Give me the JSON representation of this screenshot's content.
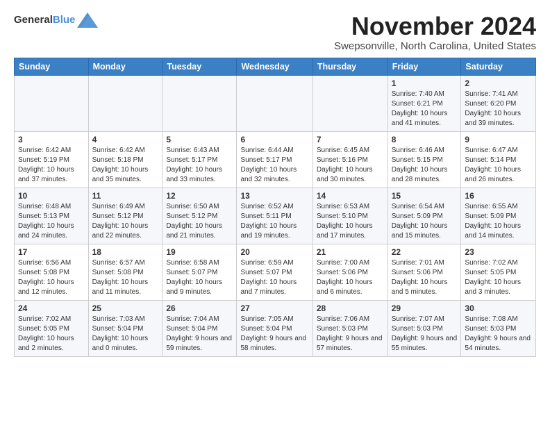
{
  "header": {
    "logo_general": "General",
    "logo_blue": "Blue",
    "month_title": "November 2024",
    "location": "Swepsonville, North Carolina, United States"
  },
  "weekdays": [
    "Sunday",
    "Monday",
    "Tuesday",
    "Wednesday",
    "Thursday",
    "Friday",
    "Saturday"
  ],
  "weeks": [
    [
      {
        "day": "",
        "info": ""
      },
      {
        "day": "",
        "info": ""
      },
      {
        "day": "",
        "info": ""
      },
      {
        "day": "",
        "info": ""
      },
      {
        "day": "",
        "info": ""
      },
      {
        "day": "1",
        "info": "Sunrise: 7:40 AM\nSunset: 6:21 PM\nDaylight: 10 hours\nand 41 minutes."
      },
      {
        "day": "2",
        "info": "Sunrise: 7:41 AM\nSunset: 6:20 PM\nDaylight: 10 hours\nand 39 minutes."
      }
    ],
    [
      {
        "day": "3",
        "info": "Sunrise: 6:42 AM\nSunset: 5:19 PM\nDaylight: 10 hours\nand 37 minutes."
      },
      {
        "day": "4",
        "info": "Sunrise: 6:42 AM\nSunset: 5:18 PM\nDaylight: 10 hours\nand 35 minutes."
      },
      {
        "day": "5",
        "info": "Sunrise: 6:43 AM\nSunset: 5:17 PM\nDaylight: 10 hours\nand 33 minutes."
      },
      {
        "day": "6",
        "info": "Sunrise: 6:44 AM\nSunset: 5:17 PM\nDaylight: 10 hours\nand 32 minutes."
      },
      {
        "day": "7",
        "info": "Sunrise: 6:45 AM\nSunset: 5:16 PM\nDaylight: 10 hours\nand 30 minutes."
      },
      {
        "day": "8",
        "info": "Sunrise: 6:46 AM\nSunset: 5:15 PM\nDaylight: 10 hours\nand 28 minutes."
      },
      {
        "day": "9",
        "info": "Sunrise: 6:47 AM\nSunset: 5:14 PM\nDaylight: 10 hours\nand 26 minutes."
      }
    ],
    [
      {
        "day": "10",
        "info": "Sunrise: 6:48 AM\nSunset: 5:13 PM\nDaylight: 10 hours\nand 24 minutes."
      },
      {
        "day": "11",
        "info": "Sunrise: 6:49 AM\nSunset: 5:12 PM\nDaylight: 10 hours\nand 22 minutes."
      },
      {
        "day": "12",
        "info": "Sunrise: 6:50 AM\nSunset: 5:12 PM\nDaylight: 10 hours\nand 21 minutes."
      },
      {
        "day": "13",
        "info": "Sunrise: 6:52 AM\nSunset: 5:11 PM\nDaylight: 10 hours\nand 19 minutes."
      },
      {
        "day": "14",
        "info": "Sunrise: 6:53 AM\nSunset: 5:10 PM\nDaylight: 10 hours\nand 17 minutes."
      },
      {
        "day": "15",
        "info": "Sunrise: 6:54 AM\nSunset: 5:09 PM\nDaylight: 10 hours\nand 15 minutes."
      },
      {
        "day": "16",
        "info": "Sunrise: 6:55 AM\nSunset: 5:09 PM\nDaylight: 10 hours\nand 14 minutes."
      }
    ],
    [
      {
        "day": "17",
        "info": "Sunrise: 6:56 AM\nSunset: 5:08 PM\nDaylight: 10 hours\nand 12 minutes."
      },
      {
        "day": "18",
        "info": "Sunrise: 6:57 AM\nSunset: 5:08 PM\nDaylight: 10 hours\nand 11 minutes."
      },
      {
        "day": "19",
        "info": "Sunrise: 6:58 AM\nSunset: 5:07 PM\nDaylight: 10 hours\nand 9 minutes."
      },
      {
        "day": "20",
        "info": "Sunrise: 6:59 AM\nSunset: 5:07 PM\nDaylight: 10 hours\nand 7 minutes."
      },
      {
        "day": "21",
        "info": "Sunrise: 7:00 AM\nSunset: 5:06 PM\nDaylight: 10 hours\nand 6 minutes."
      },
      {
        "day": "22",
        "info": "Sunrise: 7:01 AM\nSunset: 5:06 PM\nDaylight: 10 hours\nand 5 minutes."
      },
      {
        "day": "23",
        "info": "Sunrise: 7:02 AM\nSunset: 5:05 PM\nDaylight: 10 hours\nand 3 minutes."
      }
    ],
    [
      {
        "day": "24",
        "info": "Sunrise: 7:02 AM\nSunset: 5:05 PM\nDaylight: 10 hours\nand 2 minutes."
      },
      {
        "day": "25",
        "info": "Sunrise: 7:03 AM\nSunset: 5:04 PM\nDaylight: 10 hours\nand 0 minutes."
      },
      {
        "day": "26",
        "info": "Sunrise: 7:04 AM\nSunset: 5:04 PM\nDaylight: 9 hours\nand 59 minutes."
      },
      {
        "day": "27",
        "info": "Sunrise: 7:05 AM\nSunset: 5:04 PM\nDaylight: 9 hours\nand 58 minutes."
      },
      {
        "day": "28",
        "info": "Sunrise: 7:06 AM\nSunset: 5:03 PM\nDaylight: 9 hours\nand 57 minutes."
      },
      {
        "day": "29",
        "info": "Sunrise: 7:07 AM\nSunset: 5:03 PM\nDaylight: 9 hours\nand 55 minutes."
      },
      {
        "day": "30",
        "info": "Sunrise: 7:08 AM\nSunset: 5:03 PM\nDaylight: 9 hours\nand 54 minutes."
      }
    ]
  ]
}
